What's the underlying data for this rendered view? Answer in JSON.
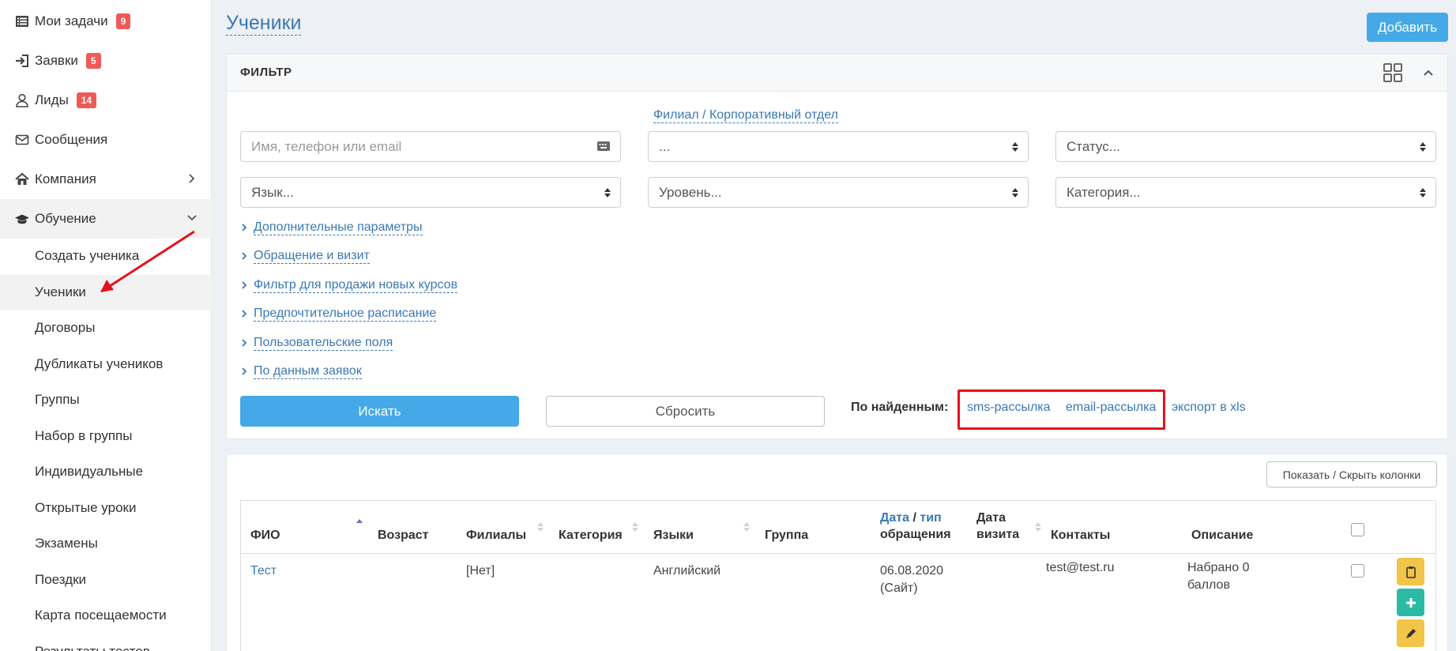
{
  "sidebar": {
    "items": [
      {
        "label": "Мои задачи",
        "badge": "9",
        "icon": "list-icon"
      },
      {
        "label": "Заявки",
        "badge": "5",
        "icon": "sign-in-icon"
      },
      {
        "label": "Лиды",
        "badge": "14",
        "icon": "user-icon"
      },
      {
        "label": "Сообщения",
        "icon": "envelope-icon"
      },
      {
        "label": "Компания",
        "icon": "home-icon"
      },
      {
        "label": "Обучение",
        "icon": "graduation-cap-icon"
      }
    ],
    "sub_items": [
      "Создать ученика",
      "Ученики",
      "Договоры",
      "Дубликаты учеников",
      "Группы",
      "Набор в группы",
      "Индивидуальные",
      "Открытые уроки",
      "Экзамены",
      "Поездки",
      "Карта посещаемости",
      "Результаты тестов"
    ]
  },
  "header": {
    "title": "Ученики",
    "add_label": "Добавить"
  },
  "filter": {
    "title": "ФИЛЬТР",
    "branch_link": "Филиал / Корпоративный отдел",
    "search_placeholder": "Имя, телефон или email",
    "branch_value": "...",
    "status_placeholder": "Статус...",
    "language_placeholder": "Язык...",
    "level_placeholder": "Уровень...",
    "category_placeholder": "Категория...",
    "expanders": [
      "Дополнительные параметры",
      "Обращение и визит",
      "Фильтр для продажи новых курсов",
      "Предпочтительное расписание",
      "Пользовательские поля",
      "По данным заявок"
    ],
    "search_label": "Искать",
    "reset_label": "Сбросить",
    "found_label": "По найденным:",
    "sms_link": "sms-рассылка",
    "email_link": "email-рассылка",
    "export_link": "экспорт в xls"
  },
  "table": {
    "toggle_columns_label": "Показать / Скрыть колонки",
    "headers": {
      "name": "ФИО",
      "age": "Возраст",
      "branches": "Филиалы",
      "category": "Категория",
      "languages": "Языки",
      "group": "Группа",
      "date_part1": "Дата",
      "date_sep": " / ",
      "date_part2": "тип",
      "date_line2": "обращения",
      "visit_line1": "Дата",
      "visit_line2": "визита",
      "contacts": "Контакты",
      "description": "Описание"
    },
    "rows": [
      {
        "name": "Тест",
        "branches": "[Нет]",
        "languages": "Английский",
        "date_line1": "06.08.2020",
        "date_line2": "(Сайт)",
        "contacts": "test@test.ru",
        "desc_line1": "Набрано 0",
        "desc_line2": "баллов"
      }
    ]
  },
  "colors": {
    "accent": "#45a9e7",
    "link": "#3a78b5",
    "badge": "#ef5a57",
    "highlight": "#e4121b",
    "yellow_btn": "#f2c447",
    "teal_btn": "#2bbba5"
  }
}
